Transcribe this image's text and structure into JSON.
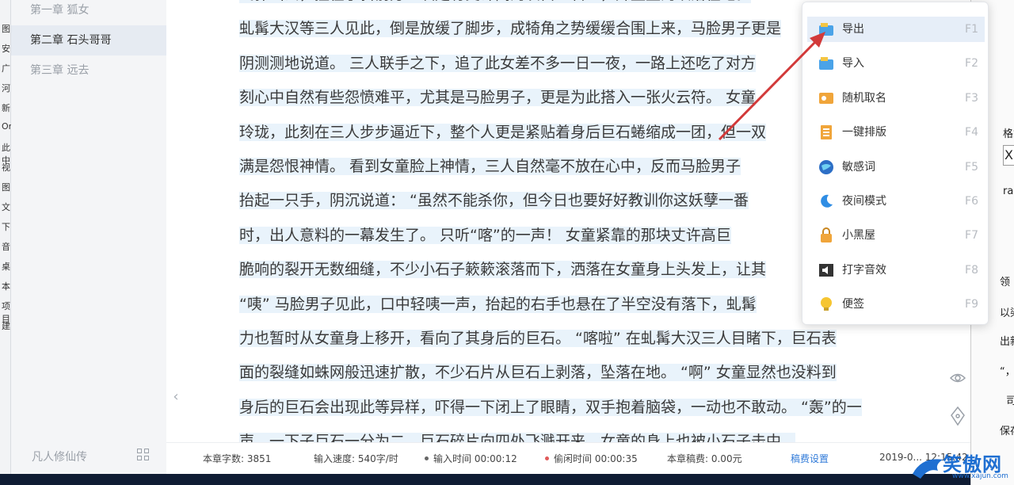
{
  "desktop_strip": [
    "图",
    "安",
    "广",
    "河",
    "新",
    "On",
    "此中",
    "视",
    "图",
    "文",
    "下",
    "音",
    "桌",
    "本",
    "项目",
    "建"
  ],
  "sidebar": {
    "chapters": [
      {
        "label": "第一章  狐女",
        "active": false
      },
      {
        "label": "第二章 石头哥哥",
        "active": true
      },
      {
        "label": "第三章 远去",
        "active": false
      }
    ],
    "book_title": "凡人修仙传"
  },
  "editor": {
    "lines": [
      "飞扑出去，撞在了斜前方一块足有丈许高的灰白巨石上，升童重的跌落在地。",
      "虬髯大汉等三人见此，倒是放缓了脚步，成犄角之势缓缓合围上来，马脸男子更是",
      "阴测测地说道。    三人联手之下，追了此女差不多一日一夜，一路上还吃了对方",
      "刻心中自然有些怨愤难平，尤其是马脸男子，更是为此搭入一张火云符。    女童",
      "玲珑，此刻在三人步步逼近下，整个人更是紧贴着身后巨石蜷缩成一团，但一双",
      "满是怨恨神情。    看到女童脸上神情，三人自然毫不放在心中，反而马脸男子",
      "抬起一只手，阴沉说道：   “虽然不能杀你，但今日也要好好教训你这妖孽一番",
      "时，出人意料的一幕发生了。    只听“喀”的一声！    女童紧靠的那块丈许高巨",
      "脆响的裂开无数细缝，不少小石子簌簌滚落而下，洒落在女童身上头发上，让其",
      "“咦”    马脸男子见此，口中轻咦一声，抬起的右手也悬在了半空没有落下，虬髯",
      "力也暂时从女童身上移开，看向了其身后的巨石。    “喀啦”    在虬髯大汉三人目睹下，巨石表",
      "面的裂缝如蛛网般迅速扩散，不少石片从巨石上剥落，坠落在地。    “啊”    女童显然也没料到",
      "身后的巨石会出现此等异样，吓得一下闭上了眼睛，双手抱着脑袋，一动也不敢动。    “轰”的一",
      "声，一下子巨石一分为二，巨石碎片向四处飞溅开来，女童的身上也被小石子击中..."
    ]
  },
  "status": {
    "word_count": "本章字数: 3851",
    "input_speed": "输入速度: 540字/时",
    "input_time": "输入时间 00:00:12",
    "idle_time": "偷闲时间 00:00:35",
    "fee": "本章稿费: 0.00元",
    "fee_settings": "稿费设置",
    "datetime": "2019-0... 12:15:42"
  },
  "menu": {
    "items": [
      {
        "label": "导出",
        "key": "F1",
        "icon": "folder-export-icon",
        "highlighted": true
      },
      {
        "label": "导入",
        "key": "F2",
        "icon": "folder-import-icon",
        "highlighted": false
      },
      {
        "label": "随机取名",
        "key": "F3",
        "icon": "id-card-icon",
        "highlighted": false
      },
      {
        "label": "一键排版",
        "key": "F4",
        "icon": "document-format-icon",
        "highlighted": false
      },
      {
        "label": "敏感词",
        "key": "F5",
        "icon": "globe-icon",
        "highlighted": false
      },
      {
        "label": "夜间模式",
        "key": "F6",
        "icon": "moon-icon",
        "highlighted": false
      },
      {
        "label": "小黑屋",
        "key": "F7",
        "icon": "lock-icon",
        "highlighted": false
      },
      {
        "label": "打字音效",
        "key": "F8",
        "icon": "speaker-icon",
        "highlighted": false
      },
      {
        "label": "便签",
        "key": "F9",
        "icon": "lightbulb-icon",
        "highlighted": false
      }
    ]
  },
  "right_window": {
    "snippets": [
      "格式",
      "X",
      "ra",
      "领",
      "以染",
      "出新",
      "“，",
      "司",
      "保存"
    ]
  },
  "watermark": {
    "text": "笑傲网",
    "url": "www.xajun.com"
  },
  "colors": {
    "accent": "#2f7ad8",
    "arrow": "#d23a3a",
    "highlight": "#e9f3fb"
  }
}
